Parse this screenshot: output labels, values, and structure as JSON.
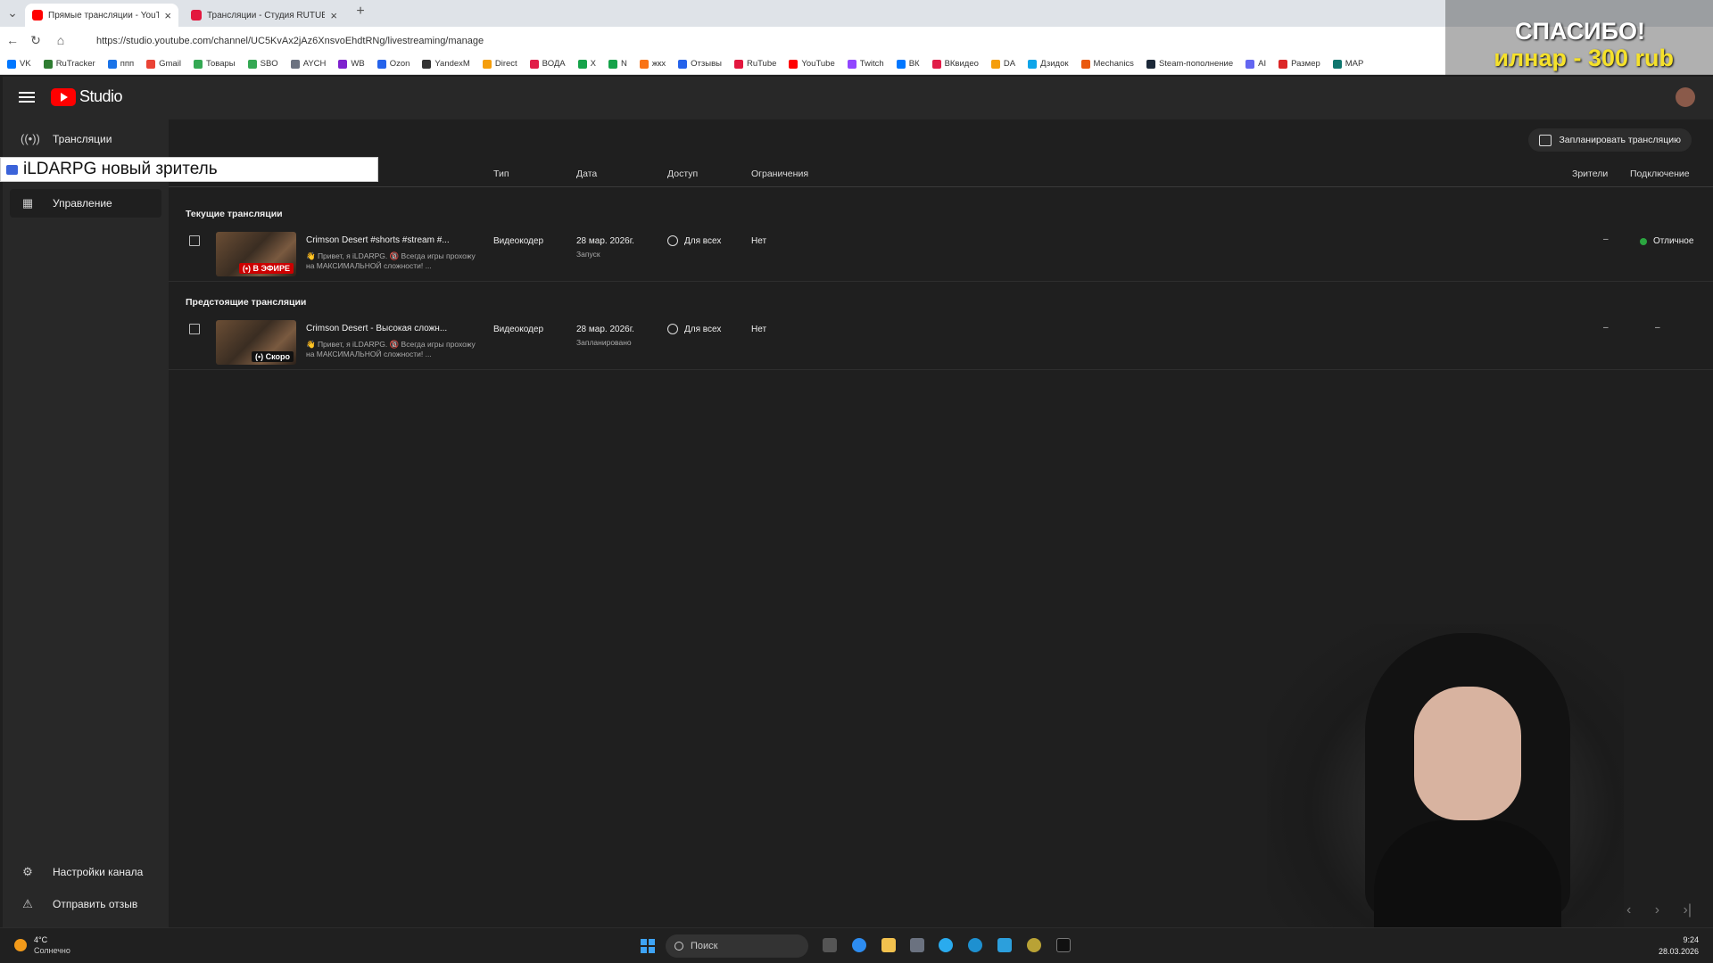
{
  "browser": {
    "tabs": [
      {
        "title": "Прямые трансляции - YouTube S",
        "active": true,
        "favicon_color": "#ff0000"
      },
      {
        "title": "Трансляции - Студия RUTUBE",
        "active": false,
        "favicon_color": "#e3173e"
      }
    ],
    "new_tab": "+",
    "url": "https://studio.youtube.com/channel/UC5KvAx2jAz6XnsvoEhdtRNg/livestreaming/manage",
    "bookmarks": [
      "VK",
      "RuTracker",
      "ппп",
      "Gmail",
      "Товары",
      "SBO",
      "AYCH",
      "WB",
      "Ozon",
      "YandexM",
      "Direct",
      "ВОДА",
      "X",
      "N",
      "жкх",
      "Отзывы",
      "RuTube",
      "YouTube",
      "Twitch",
      "ВК",
      "ВКвидео",
      "DA",
      "Дзидок",
      "Mechanics",
      "Steam-пополнение",
      "AI",
      "Размер",
      "MAP"
    ]
  },
  "donation": {
    "title": "СПАСИБО!",
    "message": "илнар - 300 rub"
  },
  "viewer_notice": "iLDARPG новый зритель",
  "studio": {
    "logo_text": "Studio",
    "sidebar": {
      "items": [
        {
          "label": "Трансляции",
          "icon": "broadcast-icon"
        },
        {
          "label": "Управление",
          "icon": "calendar-icon"
        }
      ],
      "bottom": [
        {
          "label": "Настройки канала",
          "icon": "gear-icon"
        },
        {
          "label": "Отправить отзыв",
          "icon": "feedback-icon"
        }
      ]
    },
    "schedule_button": "Запланировать трансляцию",
    "columns": {
      "type": "Тип",
      "date": "Дата",
      "access": "Доступ",
      "restrictions": "Ограничения",
      "viewers": "Зрители",
      "connection": "Подключение"
    },
    "sections": {
      "current": "Текущие трансляции",
      "upcoming": "Предстоящие трансляции"
    },
    "rows": [
      {
        "title": "Crimson Desert #shorts #stream #...",
        "desc": "👋 Привет, я iLDARPG. 🔞 Всегда игры прохожу на МАКСИМАЛЬНОЙ сложности! ...",
        "badge": "(•) В ЭФИРЕ",
        "type": "Видеокодер",
        "date": "28 мар. 2026г.",
        "date_sub": "Запуск",
        "access": "Для всех",
        "restrictions": "Нет",
        "viewers": "–",
        "connection": "Отличное"
      },
      {
        "title": "Crimson Desert - Высокая сложн...",
        "desc": "👋 Привет, я iLDARPG. 🔞 Всегда игры прохожу на МАКСИМАЛЬНОЙ сложности! ...",
        "badge": "(•) Скоро",
        "type": "Видеокодер",
        "date": "28 мар. 2026г.",
        "date_sub": "Запланировано",
        "access": "Для всех",
        "restrictions": "Нет",
        "viewers": "–",
        "connection": "–"
      }
    ],
    "pager": [
      "‹",
      "›",
      "›|"
    ]
  },
  "taskbar": {
    "weather_temp": "4°C",
    "weather_desc": "Солнечно",
    "search_placeholder": "Поиск",
    "time": "9:24",
    "date": "28.03.2026"
  },
  "colors": {
    "live_badge": "#cc0000",
    "soon_badge": "#111111",
    "connection_ok": "#2ba640"
  }
}
